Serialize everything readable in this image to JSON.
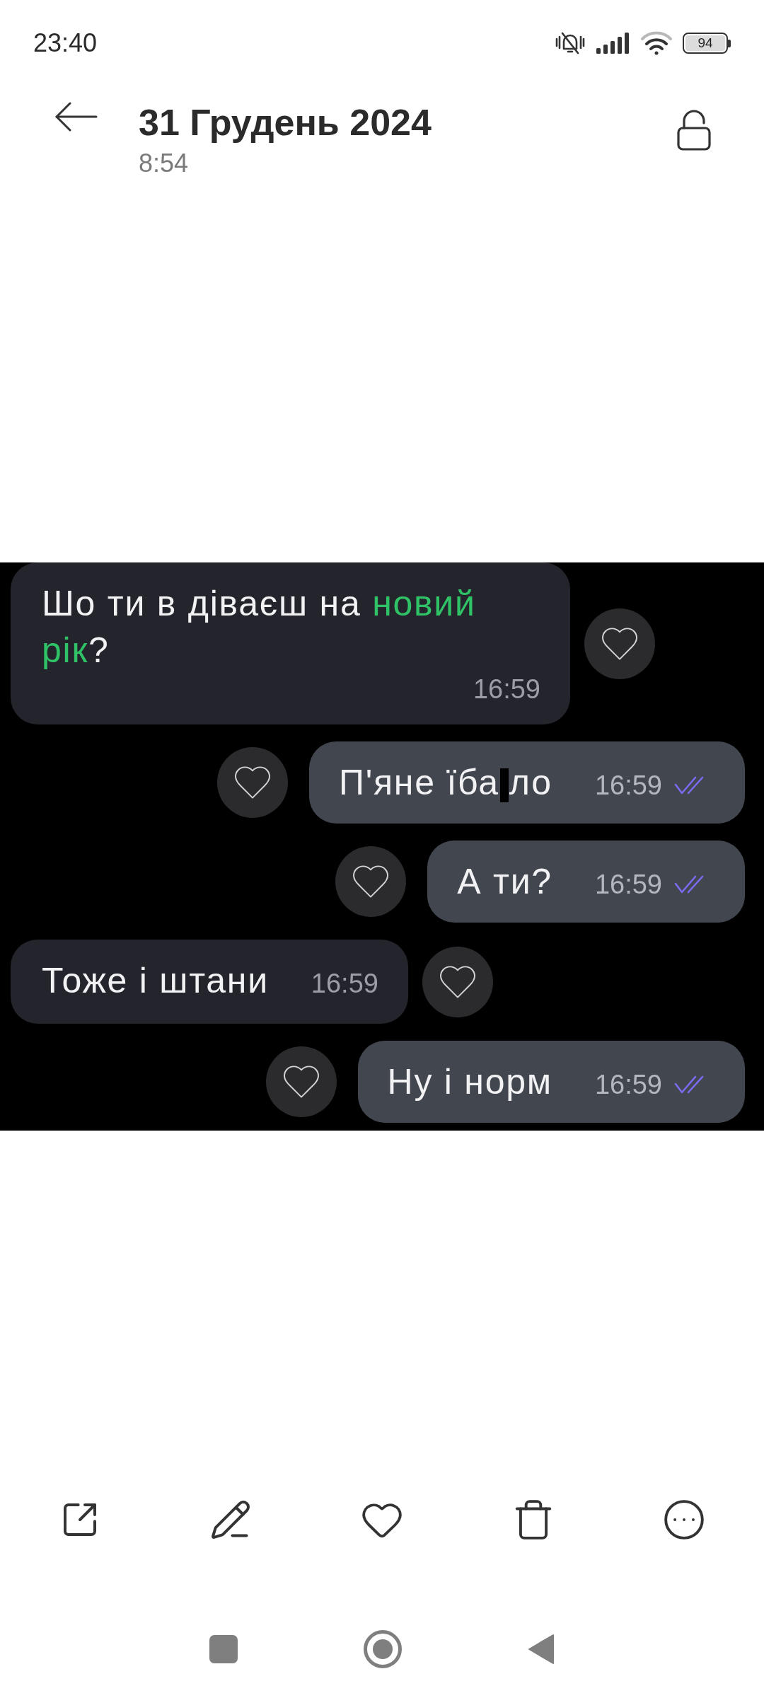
{
  "status_bar": {
    "time": "23:40",
    "battery": "94"
  },
  "header": {
    "title": "31 Грудень 2024",
    "subtitle": "8:54"
  },
  "screenshot": {
    "messages": [
      {
        "kind": "incoming",
        "segments": [
          {
            "kind": "plain",
            "text": "Шо ти в діваєш на "
          },
          {
            "kind": "highlight",
            "text": "новий рік"
          },
          {
            "kind": "plain",
            "text": "?"
          }
        ],
        "time": "16:59",
        "liked": false
      },
      {
        "kind": "outgoing",
        "segments": [
          {
            "kind": "plain",
            "text": "П'яне їба"
          },
          {
            "kind": "redaction"
          },
          {
            "kind": "plain",
            "text": "ло"
          }
        ],
        "time": "16:59",
        "read": true,
        "liked": false
      },
      {
        "kind": "outgoing",
        "segments": [
          {
            "kind": "plain",
            "text": "А ти?"
          }
        ],
        "time": "16:59",
        "read": true,
        "liked": false
      },
      {
        "kind": "incoming",
        "segments": [
          {
            "kind": "plain",
            "text": "Тоже і штани"
          }
        ],
        "time": "16:59",
        "liked": false
      },
      {
        "kind": "outgoing",
        "segments": [
          {
            "kind": "plain",
            "text": "Ну і норм"
          }
        ],
        "time": "16:59",
        "read": true,
        "liked": false
      }
    ]
  },
  "toolbar": {
    "favorite": false
  }
}
